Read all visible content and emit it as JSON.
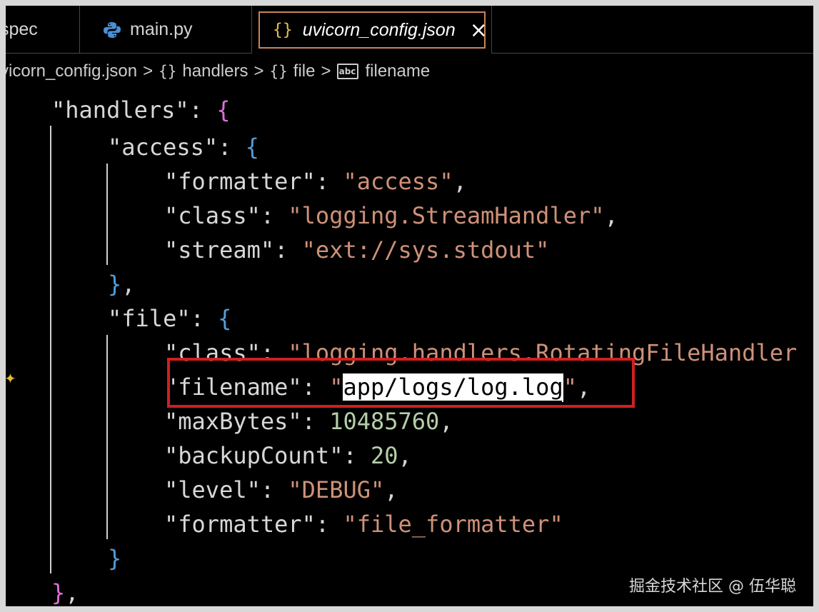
{
  "tabs": [
    {
      "label": "spec"
    },
    {
      "label": "main.py",
      "icon": "python-icon"
    },
    {
      "label": "uvicorn_config.json",
      "icon": "json-braces-icon",
      "active": true
    }
  ],
  "active_tab_icon_text": "{}",
  "close_glyph": "×",
  "breadcrumb": {
    "file": "vicorn_config.json",
    "handlers_icon": "{}",
    "handlers": "handlers",
    "file_icon": "{}",
    "file_node": "file",
    "filename_icon": "abc",
    "filename": "filename",
    "sep": ">"
  },
  "code": {
    "handlers_key": "\"handlers\"",
    "access_key": "\"access\"",
    "access_formatter_key": "\"formatter\"",
    "access_formatter_val": "\"access\"",
    "access_class_key": "\"class\"",
    "access_class_val": "\"logging.StreamHandler\"",
    "access_stream_key": "\"stream\"",
    "access_stream_val": "\"ext://sys.stdout\"",
    "file_key": "\"file\"",
    "file_class_key": "\"class\"",
    "file_class_val": "\"logging.handlers.RotatingFileHandler",
    "filename_key": "\"filename\"",
    "filename_quote_open": "\"",
    "filename_val": "app/logs/log.log",
    "filename_quote_close": "\"",
    "maxbytes_key": "\"maxBytes\"",
    "maxbytes_val": "10485760",
    "backupcount_key": "\"backupCount\"",
    "backupcount_val": "20",
    "level_key": "\"level\"",
    "level_val": "\"DEBUG\"",
    "file_formatter_key": "\"formatter\"",
    "file_formatter_val": "\"file_formatter\""
  },
  "colors": {
    "key": "#9cdcfe",
    "string": "#ce9178",
    "number": "#b5cea8",
    "highlight_box": "#d02020",
    "active_tab_border": "#c9845a"
  },
  "watermark": "掘金技术社区 @ 伍华聪"
}
